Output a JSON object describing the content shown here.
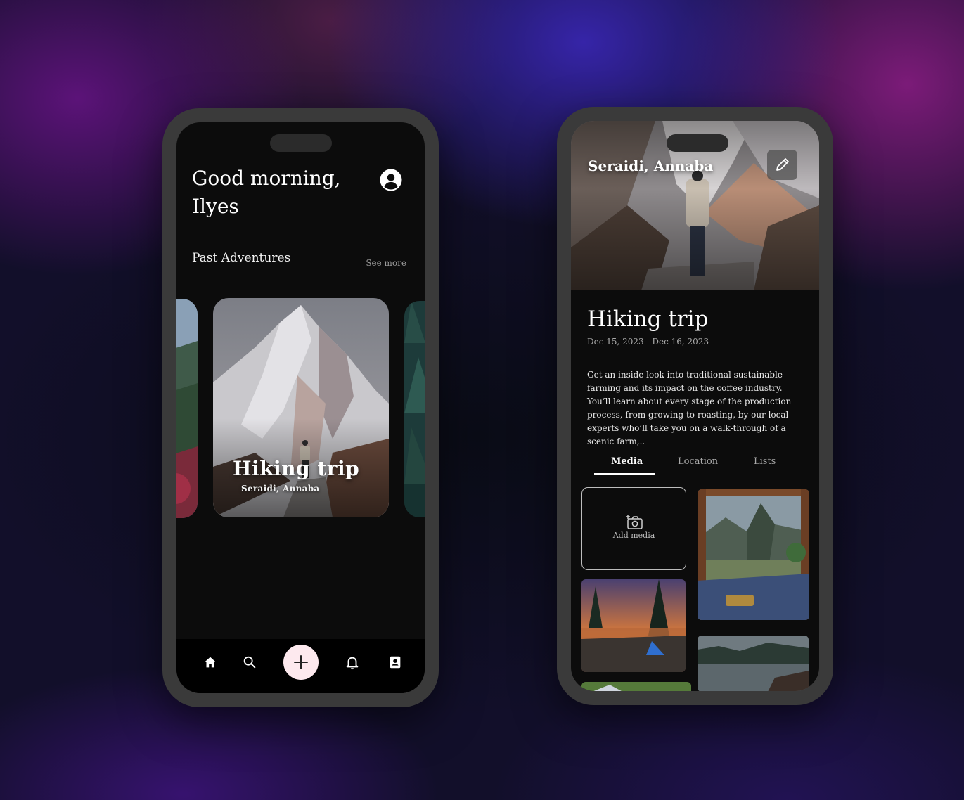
{
  "left_screen": {
    "greeting": "Good morning, Ilyes",
    "past_adventures_title": "Past Adventures",
    "see_more": "See more",
    "featured_card": {
      "title": "Hiking trip",
      "location": "Seraidi, Annaba"
    },
    "nav_icons": [
      "home-icon",
      "search-icon",
      "plus-icon",
      "bell-icon",
      "contact-book-icon"
    ]
  },
  "right_screen": {
    "hero_location": "Seraidi, Annaba",
    "trip_title": "Hiking trip",
    "dates": "Dec 15, 2023 - Dec 16, 2023",
    "description": "Get an inside look into traditional sustainable farming and its impact on the coffee industry. You’ll learn about every stage of the production process, from growing to roasting, by our local experts who’ll take you on a walk-through of a scenic farm,..",
    "tabs": [
      {
        "label": "Media",
        "active": true
      },
      {
        "label": "Location",
        "active": false
      },
      {
        "label": "Lists",
        "active": false
      }
    ],
    "add_media_label": "Add media"
  },
  "colors": {
    "screen_bg": "#0c0c0c",
    "phone_frame": "#3a3a3a",
    "fab_bg": "#fde9ee",
    "muted_text": "#a9a9a9"
  }
}
